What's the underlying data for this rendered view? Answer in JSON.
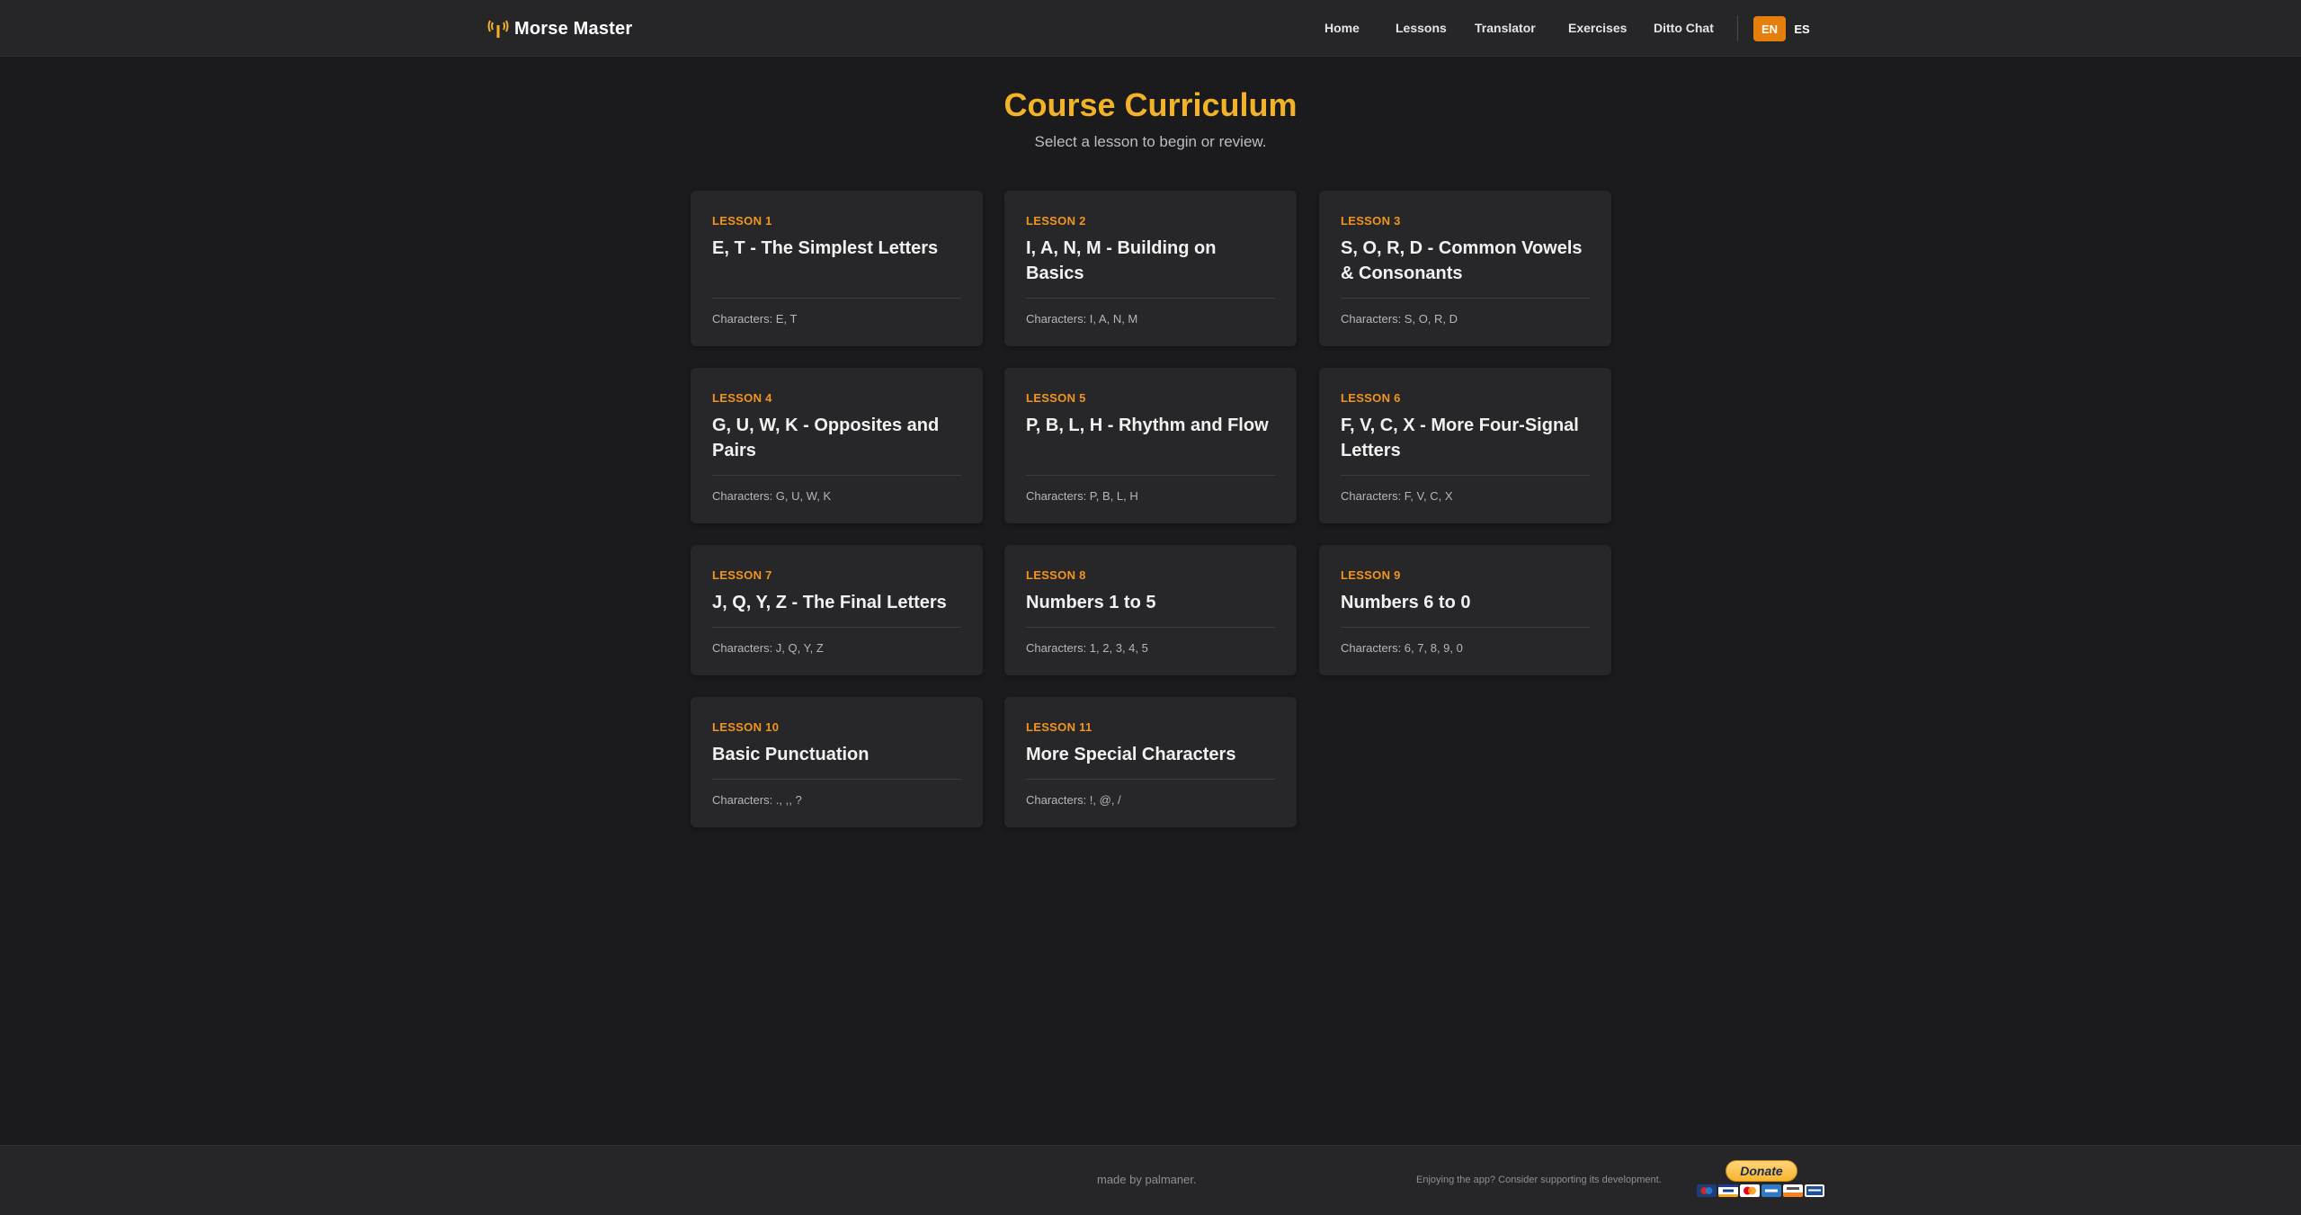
{
  "header": {
    "brand": "Morse Master",
    "brand_icon": "antenna-icon",
    "nav": [
      "Home",
      "Lessons",
      "Translator",
      "Exercises",
      "Ditto Chat"
    ],
    "languages": [
      "EN",
      "ES"
    ],
    "active_language": "EN"
  },
  "main": {
    "title": "Course Curriculum",
    "subtitle": "Select a lesson to begin or review.",
    "lessons": [
      {
        "label": "LESSON 1",
        "title": "E, T - The Simplest Letters",
        "characters": "Characters: E, T"
      },
      {
        "label": "LESSON 2",
        "title": "I, A, N, M - Building on Basics",
        "characters": "Characters: I, A, N, M"
      },
      {
        "label": "LESSON 3",
        "title": "S, O, R, D - Common Vowels & Consonants",
        "characters": "Characters: S, O, R, D"
      },
      {
        "label": "LESSON 4",
        "title": "G, U, W, K - Opposites and Pairs",
        "characters": "Characters: G, U, W, K"
      },
      {
        "label": "LESSON 5",
        "title": "P, B, L, H - Rhythm and Flow",
        "characters": "Characters: P, B, L, H"
      },
      {
        "label": "LESSON 6",
        "title": "F, V, C, X - More Four-Signal Letters",
        "characters": "Characters: F, V, C, X"
      },
      {
        "label": "LESSON 7",
        "title": "J, Q, Y, Z - The Final Letters",
        "characters": "Characters: J, Q, Y, Z"
      },
      {
        "label": "LESSON 8",
        "title": "Numbers 1 to 5",
        "characters": "Characters: 1, 2, 3, 4, 5"
      },
      {
        "label": "LESSON 9",
        "title": "Numbers 6 to 0",
        "characters": "Characters: 6, 7, 8, 9, 0"
      },
      {
        "label": "LESSON 10",
        "title": "Basic Punctuation",
        "characters": "Characters: ., ,, ?"
      },
      {
        "label": "LESSON 11",
        "title": "More Special Characters",
        "characters": "Characters: !, @, /"
      }
    ]
  },
  "footer": {
    "made_by": "made by palmaner.",
    "support_text": "Enjoying the app? Consider supporting its development.",
    "donate_label": "Donate"
  },
  "colors": {
    "accent": "#f2b328",
    "lesson_label": "#f0951e",
    "active_lang_bg": "#e47f0d",
    "background": "#1b1b1d",
    "card": "#27272a"
  }
}
